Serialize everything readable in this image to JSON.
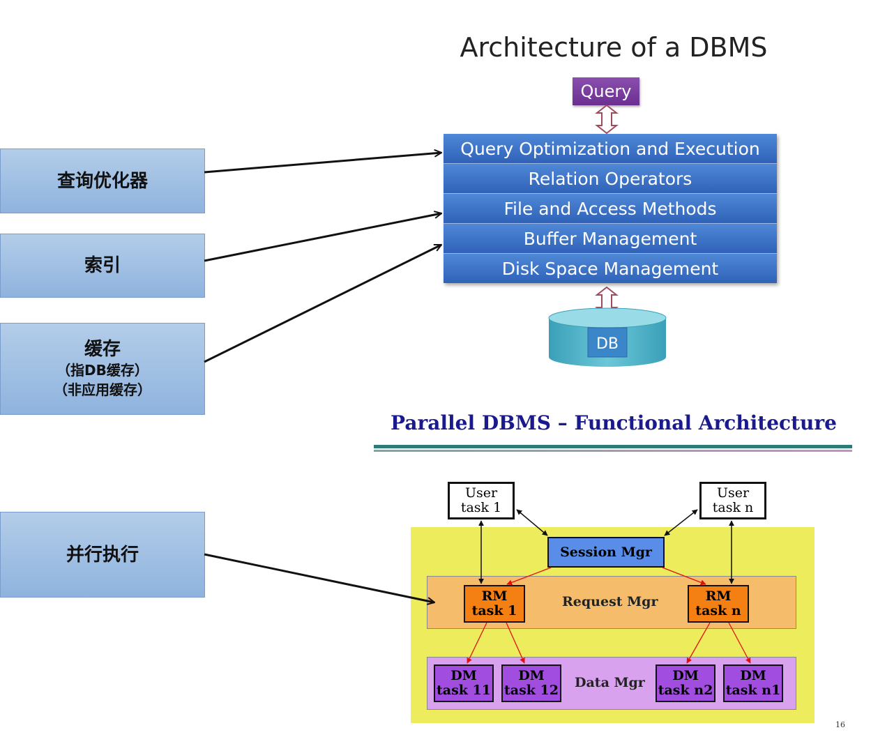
{
  "left_boxes": {
    "optimizer": "查询优化器",
    "index": "索引",
    "cache": {
      "main": "缓存",
      "line2": "（指DB缓存）",
      "line3": "（非应用缓存）"
    },
    "parallel": "并行执行"
  },
  "dbms": {
    "title": "Architecture of a DBMS",
    "query": "Query",
    "layers": [
      "Query Optimization and Execution",
      "Relation Operators",
      "File and Access Methods",
      "Buffer Management",
      "Disk Space Management"
    ],
    "db": "DB"
  },
  "parallel": {
    "title": "Parallel DBMS – Functional Architecture",
    "user1": {
      "line1": "User",
      "line2": "task 1"
    },
    "usern": {
      "line1": "User",
      "line2": "task n"
    },
    "session": "Session Mgr",
    "request": "Request Mgr",
    "data": "Data Mgr",
    "rm1": {
      "line1": "RM",
      "line2": "task 1"
    },
    "rmn": {
      "line1": "RM",
      "line2": "task n"
    },
    "dm": [
      {
        "line1": "DM",
        "line2": "task 11"
      },
      {
        "line1": "DM",
        "line2": "task 12"
      },
      {
        "line1": "DM",
        "line2": "task n2"
      },
      {
        "line1": "DM",
        "line2": "task n1"
      }
    ]
  },
  "page_number": "16",
  "colors": {
    "left_box": "#a8c4e6",
    "layer_blue": "#3d74c8",
    "query_purple": "#7a3fa0",
    "db_teal": "#4fb5c9",
    "panel_yellow": "#ecec5c",
    "request_orange": "#f5bd6b",
    "data_purple": "#d9a2ee",
    "title_navy": "#1a1a8c"
  }
}
